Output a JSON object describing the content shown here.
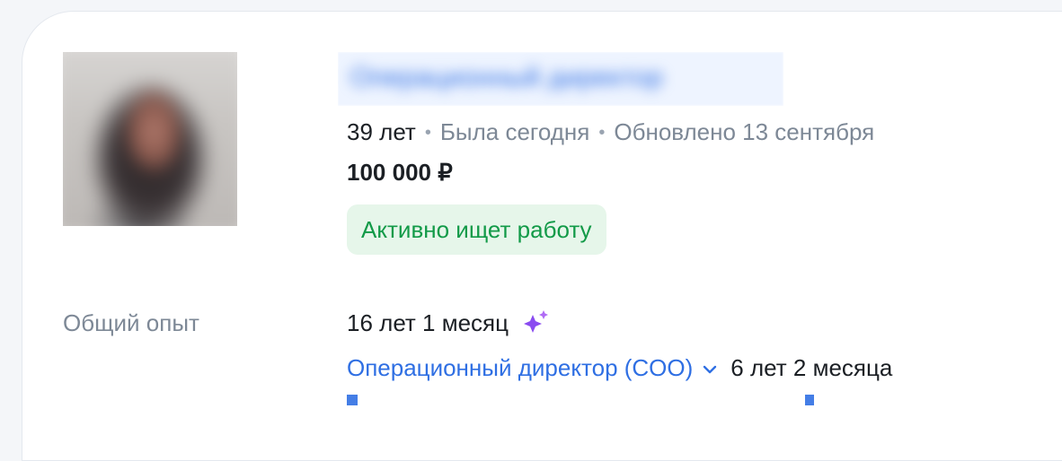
{
  "profile": {
    "photo_icon": "avatar-blurred",
    "title": "Операционный директор",
    "age": "39 лет",
    "last_seen": "Была сегодня",
    "updated": "Обновлено 13 сентября",
    "salary": "100 000 ₽",
    "status": "Активно ищет работу"
  },
  "experience": {
    "label": "Общий опыт",
    "total": "16 лет 1 месяц",
    "sparkle_icon": "ai-sparkle-icon",
    "jobs": [
      {
        "title": "Операционный директор (COO)",
        "duration": "6 лет  2 месяца"
      }
    ]
  },
  "colors": {
    "link": "#2f6fe3",
    "muted": "#7d8896",
    "badge_bg": "#e6f6ea",
    "badge_text": "#129a48",
    "sparkle": "#8a4bf0"
  }
}
